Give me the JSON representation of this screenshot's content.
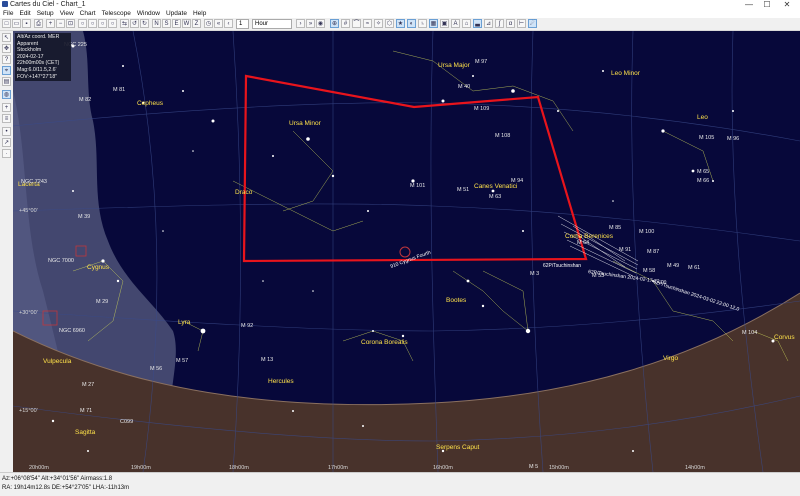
{
  "window": {
    "title": "Cartes du Ciel - Chart_1",
    "min": "—",
    "max": "☐",
    "close": "✕"
  },
  "menu": [
    "File",
    "Edit",
    "Setup",
    "View",
    "Chart",
    "Telescope",
    "Window",
    "Update",
    "Help"
  ],
  "toolbar": {
    "field_value": "1",
    "time_unit": "Hour"
  },
  "info_panel": {
    "line1": "Alt/Az coord. MER",
    "line2": "Apparent",
    "line3": "Stockholm",
    "line4": "2024-02-17",
    "line5": "22h00m00s (CET)",
    "line6": "Mag:6.0/11.5,2.6'",
    "line7": "FOV:+147°27'18\""
  },
  "labels": {
    "ngc225": "NGC 225",
    "cepheus": "Cepheus",
    "ursa_minor": "Ursa Minor",
    "ursa_major": "Ursa Major",
    "draco": "Draco",
    "lacerta": "Lacerta",
    "cygnus": "Cygnus",
    "lyra": "Lyra",
    "vulpecula": "Vulpecula",
    "sagitta": "Sagitta",
    "hercules": "Hercules",
    "corona_borealis": "Corona Borealis",
    "bootes": "Bootes",
    "canes_venatici": "Canes Venatici",
    "coma_berenices": "Coma Berenices",
    "leo_minor": "Leo Minor",
    "leo": "Leo",
    "virgo": "Virgo",
    "corvus": "Corvus",
    "serpens_caput": "Serpens Caput",
    "ngc7000": "NGC 7000",
    "ngc6960": "NGC 6960",
    "ngc7243": "NGC 7243",
    "c099": "C099",
    "comet1": "62P/Tsuchinshan",
    "comet2": "62P/Tsuchinshan 2024-02-17 22:00",
    "comet3": "62P/Tsuchinshan 2024-03-02 22:00 12.0",
    "neptune_ref": "910 Cygnus Fourth",
    "messier": [
      "M 97",
      "M 109",
      "M 108",
      "M 101",
      "M 51",
      "M 94",
      "M 63",
      "M 3",
      "M 53",
      "M 64",
      "M 85",
      "M 100",
      "M 91",
      "M 87",
      "M 58",
      "M 49",
      "M 61",
      "M 105",
      "M 96",
      "M 65",
      "M 66",
      "M 39",
      "M 29",
      "M 57",
      "M 56",
      "M 27",
      "M 71",
      "M 13",
      "M 92",
      "M 82",
      "M 81",
      "M 5",
      "M 104",
      "M 40"
    ],
    "dec_lines": [
      "+45°00'",
      "+30°00'",
      "+15°00'"
    ],
    "ra_ticks": [
      "20h00m",
      "19h00m",
      "18h00m",
      "17h00m",
      "16h00m",
      "15h00m",
      "14h00m"
    ]
  },
  "status": {
    "line1": "Az:+06°08'54\" Alt:+34°01'56\" Airmass:1.8",
    "line2": "RA: 19h14m12.8s DE:+54°27'05\" LHA:-11h13m"
  },
  "colors": {
    "sky": "#07083a",
    "ground": "#48322b",
    "milkyway": "#4a4f76",
    "selection": "#e8141c",
    "label": "#ffe24a"
  }
}
